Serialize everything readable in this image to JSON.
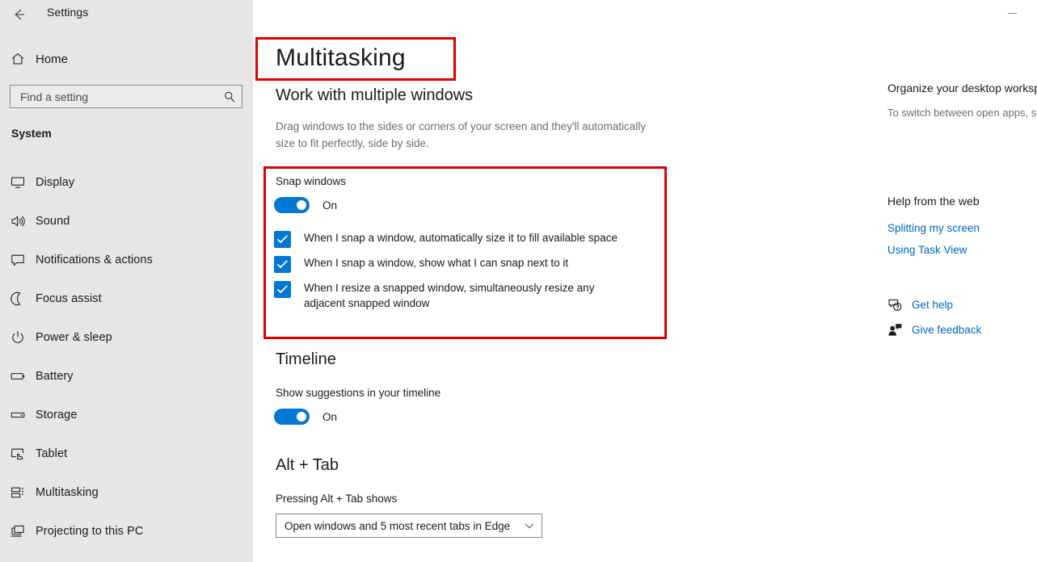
{
  "window": {
    "app_title": "Settings",
    "back_icon": "back-arrow-icon",
    "minimize_icon": "minimize-icon"
  },
  "sidebar": {
    "home": {
      "label": "Home",
      "icon": "home-icon"
    },
    "search": {
      "value": "",
      "placeholder": "Find a setting",
      "icon": "search-icon"
    },
    "group_label": "System",
    "items": [
      {
        "label": "Display",
        "icon": "monitor-icon"
      },
      {
        "label": "Sound",
        "icon": "speaker-icon"
      },
      {
        "label": "Notifications & actions",
        "icon": "speech-bubble-icon"
      },
      {
        "label": "Focus assist",
        "icon": "moon-icon"
      },
      {
        "label": "Power & sleep",
        "icon": "power-icon"
      },
      {
        "label": "Battery",
        "icon": "battery-icon"
      },
      {
        "label": "Storage",
        "icon": "drive-icon"
      },
      {
        "label": "Tablet",
        "icon": "tablet-hand-icon"
      },
      {
        "label": "Multitasking",
        "icon": "multitasking-icon"
      },
      {
        "label": "Projecting to this PC",
        "icon": "projecting-icon"
      }
    ]
  },
  "main": {
    "page_title": "Multitasking",
    "work_heading": "Work with multiple windows",
    "work_description": "Drag windows to the sides or corners of your screen and they'll automatically size to fit perfectly, side by side.",
    "snap": {
      "label": "Snap windows",
      "toggle_state": "On",
      "checkboxes": [
        {
          "label": "When I snap a window, automatically size it to fill available space",
          "checked": true
        },
        {
          "label": "When I snap a window, show what I can snap next to it",
          "checked": true
        },
        {
          "label": "When I resize a snapped window, simultaneously resize any adjacent snapped window",
          "checked": true
        }
      ]
    },
    "timeline": {
      "heading": "Timeline",
      "label": "Show suggestions in your timeline",
      "toggle_state": "On"
    },
    "alt_tab": {
      "heading": "Alt + Tab",
      "label": "Pressing Alt + Tab shows",
      "selected": "Open windows and 5 most recent tabs in Edge",
      "chevron_icon": "chevron-down-icon"
    }
  },
  "right_panel": {
    "title": "Organize your desktop workspace",
    "body": "To switch between open apps, select the Task View button on the taskbar or press Alt + Tab.",
    "help_title": "Help from the web",
    "links": [
      "Splitting my screen",
      "Using Task View"
    ],
    "actions": [
      {
        "label": "Get help",
        "icon": "get-help-icon"
      },
      {
        "label": "Give feedback",
        "icon": "give-feedback-icon"
      }
    ]
  },
  "colors": {
    "accent": "#0078d4",
    "link": "#0067c0",
    "annotation": "#e00000",
    "sidebar_bg": "#e6e6e6"
  }
}
